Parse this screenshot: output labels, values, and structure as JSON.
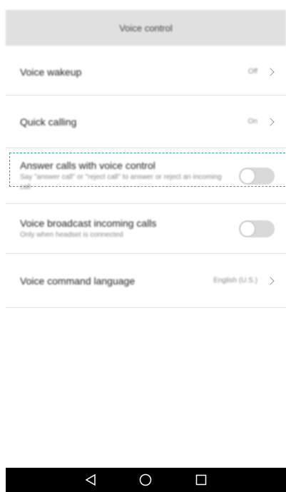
{
  "header": {
    "title": "Voice control"
  },
  "items": [
    {
      "title": "Voice wakeup",
      "value": "Off",
      "control": "chevron"
    },
    {
      "title": "Quick calling",
      "value": "On",
      "control": "chevron"
    },
    {
      "title": "Answer calls with voice control",
      "subtitle": "Say \"answer call\" or \"reject call\" to answer or reject an incoming call",
      "control": "toggle",
      "toggle_on": false
    },
    {
      "title": "Voice broadcast incoming calls",
      "subtitle": "Only when headset is connected",
      "control": "toggle",
      "toggle_on": false
    },
    {
      "title": "Voice command language",
      "value": "English (U.S.)",
      "control": "chevron"
    }
  ],
  "icons": {
    "back": "back-triangle-icon",
    "home": "home-circle-icon",
    "recents": "recents-square-icon"
  },
  "colors": {
    "highlight": "#2aa8b8",
    "header_bg": "#e0e0e0",
    "navbar_bg": "#000000"
  }
}
